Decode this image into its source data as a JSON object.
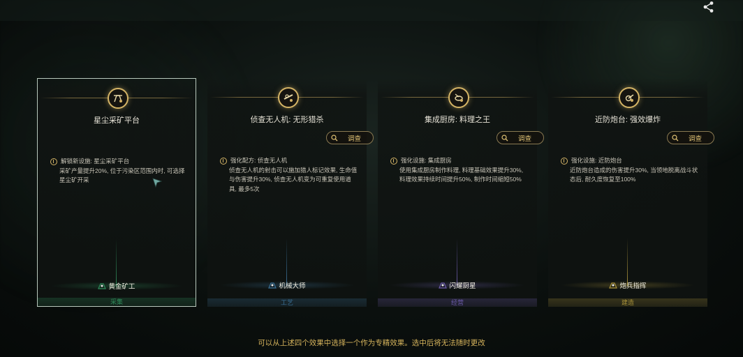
{
  "cards": [
    {
      "title": "星尘采矿平台",
      "desc_head": "解锁新设施: 星尘采矿平台",
      "desc_body": "采矿产量提升20%, 位于污染区范围内时, 可选择星尘矿开采",
      "role": "黄金矿工",
      "category": "采集",
      "accent": "#2f8a5a",
      "emblem_icon": "mining-platform-icon",
      "selected": true,
      "has_investigate": false
    },
    {
      "title": "侦查无人机: 无形猎杀",
      "desc_head": "强化配方: 侦查无人机",
      "desc_body": "侦查无人机的射击可以施加猎人标记效果, 生命值与伤害提升30%, 侦查无人机变为可重复使用道具, 最多5次",
      "role": "机械大师",
      "category": "工艺",
      "accent": "#3a6f95",
      "emblem_icon": "drone-icon",
      "selected": false,
      "has_investigate": true
    },
    {
      "title": "集成厨房: 料理之王",
      "desc_head": "强化设施: 集成厨房",
      "desc_body": "使用集成厨房制作料理, 料理基础效果提升30%, 料理效果持续时间提升50%, 制作时间缩短50%",
      "role": "闪耀厨星",
      "category": "经营",
      "accent": "#6a5aa8",
      "emblem_icon": "kitchen-icon",
      "selected": false,
      "has_investigate": true
    },
    {
      "title": "近防炮台: 强效爆炸",
      "desc_head": "强化设施: 近防炮台",
      "desc_body": "近防炮台造成的伤害提升30%, 当领地脱离战斗状态后, 耐久度恢复至100%",
      "role": "炮兵指挥",
      "category": "建造",
      "accent": "#a8913a",
      "emblem_icon": "turret-icon",
      "selected": false,
      "has_investigate": true
    }
  ],
  "investigate_label": "调查",
  "hint": "可以从上述四个效果中选择一个作为专精效果。选中后将无法随时更改",
  "icons": {
    "share": "share-icon",
    "search": "search-icon",
    "cursor": "pointer-cursor-icon"
  }
}
